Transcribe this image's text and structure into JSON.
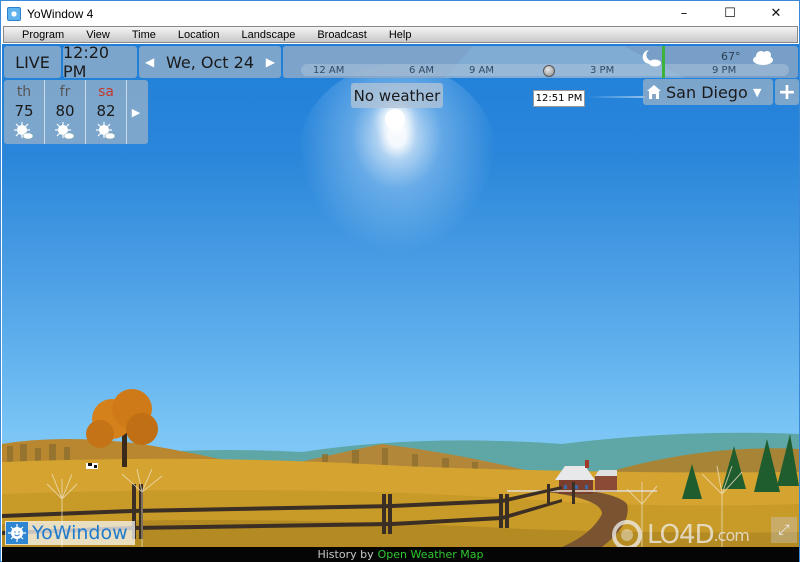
{
  "window": {
    "title": "YoWindow 4",
    "controls": {
      "minimize": "–",
      "maximize": "☐",
      "close": "✕"
    }
  },
  "menu": [
    "Program",
    "View",
    "Time",
    "Location",
    "Landscape",
    "Broadcast",
    "Help"
  ],
  "toolbar": {
    "live_label": "LIVE",
    "time": "12:20 PM",
    "date": "We, Oct 24",
    "prev_icon": "◀",
    "next_icon": "▶"
  },
  "timeline": {
    "ticks": [
      "12 AM",
      "6 AM",
      "9 AM",
      "3 PM",
      "9 PM"
    ],
    "temp": "67°",
    "icons": [
      "moon-cloud-icon",
      "cloud-icon"
    ],
    "cursor_time": "12:51 PM"
  },
  "forecast": {
    "days": [
      {
        "name": "th",
        "temp": "75",
        "icon": "sun-cloud-icon",
        "weekend": false
      },
      {
        "name": "fr",
        "temp": "80",
        "icon": "sun-cloud-icon",
        "weekend": false
      },
      {
        "name": "sa",
        "temp": "82",
        "icon": "sun-cloud-icon",
        "weekend": true
      }
    ],
    "next_icon": "▶"
  },
  "weather_status": "No weather",
  "location": {
    "name": "San Diego",
    "home_icon": "home-icon",
    "dropdown_icon": "▼",
    "add_label": "+"
  },
  "branding": {
    "logo_text": "YoWindow",
    "watermark": "LO4D",
    "watermark_suffix": ".com"
  },
  "fullscreen_icon": "⤢",
  "status": {
    "prefix": "History by",
    "link": "Open Weather Map"
  },
  "colors": {
    "accent": "#2e86d2",
    "now_line": "#3cb43c",
    "weekend": "#c0392b",
    "status_link": "#2ec82e"
  }
}
